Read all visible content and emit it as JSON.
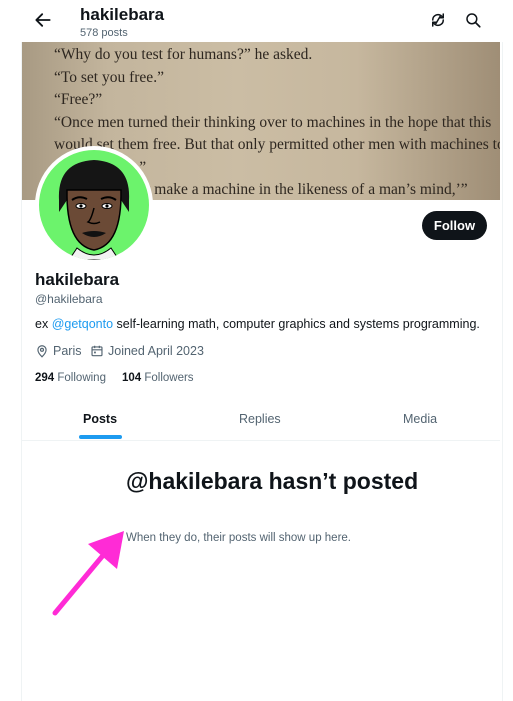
{
  "header": {
    "title": "hakilebara",
    "subtitle": "578 posts"
  },
  "banner": {
    "lines": [
      "“Why do you test for humans?” he asked.",
      "“To set you free.”",
      "“Free?”",
      "“Once men turned their thinking over to machines in the hope that this",
      "would set them free. But that only permitted other men with machines to",
      "enslave them.”",
      "            “Thou shalt not make a machine in the likeness of a man’s mind,’”"
    ]
  },
  "profile": {
    "follow_label": "Follow",
    "name": "hakilebara",
    "handle": "@hakilebara",
    "bio_prefix": "ex ",
    "bio_link": "@getqonto",
    "bio_suffix": " self-learning math, computer graphics and systems programming.",
    "location": "Paris",
    "joined": "Joined April 2023",
    "following_count": "294",
    "following_label": "Following",
    "followers_count": "104",
    "followers_label": "Followers"
  },
  "tabs": [
    {
      "label": "Posts"
    },
    {
      "label": "Replies"
    },
    {
      "label": "Media"
    }
  ],
  "empty_state": {
    "title": "@hakilebara hasn’t posted",
    "subtitle": "When they do, their posts will show up here."
  },
  "colors": {
    "accent": "#1d9bf0",
    "avatar_bg": "#6cf36c",
    "annotation_arrow": "#ff2bd6"
  }
}
